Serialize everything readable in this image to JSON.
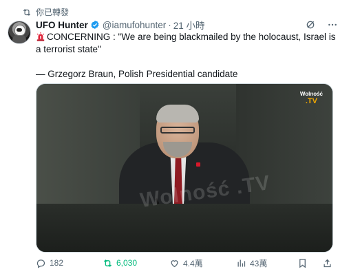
{
  "repost_banner": {
    "text": "你已轉發"
  },
  "author": {
    "name": "UFO Hunter",
    "handle": "@iamufohunter",
    "separator": "·",
    "time": "21 小時"
  },
  "tweet": {
    "line1": "CONCERNING : \"We are being blackmailed by the holocaust, Israel is a terrorist state\"",
    "line2": "— Grzegorz Braun, Polish Presidential candidate"
  },
  "media": {
    "logo_top": "Wolność",
    "logo_bottom": ".TV",
    "watermark": "Wolność .TV"
  },
  "actions": {
    "replies": "182",
    "reposts": "6,030",
    "likes": "4.4萬",
    "views": "43萬"
  },
  "colors": {
    "repost_active": "#00ba7c",
    "verified": "#1d9bf0",
    "secondary_text": "#536471"
  },
  "icons": [
    "repost-icon",
    "verified-badge-icon",
    "grok-icon",
    "more-icon",
    "siren-emoji-icon",
    "reply-icon",
    "like-icon",
    "views-icon",
    "bookmark-icon",
    "share-icon"
  ]
}
